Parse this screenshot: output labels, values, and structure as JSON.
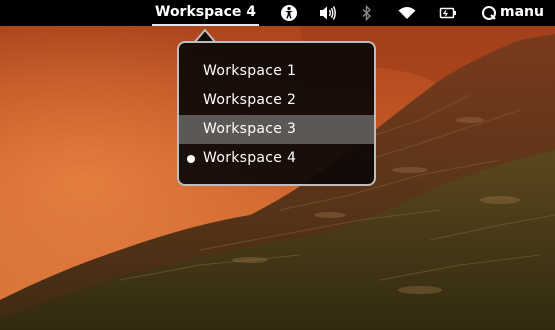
{
  "topbar": {
    "workspace_indicator": "Workspace 4",
    "user": "manu",
    "icons": [
      "accessibility-icon",
      "volume-icon",
      "bluetooth-icon",
      "wifi-icon",
      "battery-icon",
      "user-status-icon"
    ]
  },
  "workspace_menu": {
    "items": [
      {
        "label": "Workspace 1",
        "active": false,
        "hovered": false
      },
      {
        "label": "Workspace 2",
        "active": false,
        "hovered": false
      },
      {
        "label": "Workspace 3",
        "active": false,
        "hovered": true
      },
      {
        "label": "Workspace 4",
        "active": true,
        "hovered": false
      }
    ]
  },
  "colors": {
    "panel": "#000000",
    "menu_bg": "#0c0806",
    "menu_border": "#bdbdbd",
    "hover": "#5b5856",
    "wallpaper_sky": "#c8541e",
    "wallpaper_ground": "#4d2e16"
  }
}
